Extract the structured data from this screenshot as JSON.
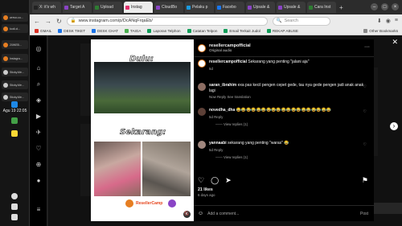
{
  "taskbar": {
    "windows": [
      "wrevo.co...",
      "kodi-cl...",
      "20WEB...",
      "Instagra...",
      "Sticky.Me...",
      "Sticky.Me...",
      "Sticky.Me..."
    ],
    "clock": "Agu 19 22:05"
  },
  "browser": {
    "tabs": [
      {
        "label": "X: it's wh",
        "color": "#222",
        "active": false
      },
      {
        "label": "Target A",
        "color": "#8a44c6",
        "active": false
      },
      {
        "label": "Upload",
        "color": "#2e7d32",
        "active": false
      },
      {
        "label": "Instag",
        "color": "#e1306c",
        "active": true
      },
      {
        "label": "CloudBo",
        "color": "#8a44c6",
        "active": false
      },
      {
        "label": "Pelaku p",
        "color": "#1b9be0",
        "active": false
      },
      {
        "label": "Facebo",
        "color": "#1877f2",
        "active": false
      },
      {
        "label": "Upsale &",
        "color": "#8a44c6",
        "active": false
      },
      {
        "label": "Upsale &",
        "color": "#8a44c6",
        "active": false
      },
      {
        "label": "Cara Inst",
        "color": "#2e7d32",
        "active": false
      }
    ],
    "new_tab": "+",
    "url": "www.instagram.com/p/DcANqFrqaEb/",
    "search_placeholder": "Search",
    "bookmarks": [
      {
        "label": "GMAIL",
        "color": "#d93025"
      },
      {
        "label": "DESK TIKET",
        "color": "#1a73e8"
      },
      {
        "label": "DESK CHAT",
        "color": "#1a73e8"
      },
      {
        "label": "TAIGA",
        "color": "#4caf50"
      },
      {
        "label": "Laporan Telphon",
        "color": "#0f9d58"
      },
      {
        "label": "Catatan Telpon",
        "color": "#0f9d58"
      },
      {
        "label": "Email Terkait Judol",
        "color": "#0f9d58"
      },
      {
        "label": "REKAP ABUSE",
        "color": "#0f9d58"
      }
    ],
    "other_bookmarks": "Other Bookmarks"
  },
  "post": {
    "media": {
      "top_caption": "Dulu:",
      "bottom_caption": "Sekarang:",
      "brand": "ResellerCamp"
    },
    "header": {
      "username": "resellercampofficial",
      "subtitle": "Original audio"
    },
    "comments": [
      {
        "user": "resellercampofficial",
        "text": "Sekarang yang penting \"jalani aja\"",
        "meta": "5d",
        "replies": ""
      },
      {
        "user": "saran_ibrahim",
        "text": "exa pas kecil pengen cepet gede, tau nya gede pengen jadi anak anak lagi",
        "meta": "Now   Reply   See translation",
        "replies": ""
      },
      {
        "user": "novedha_dha",
        "text": "😂😂😂😂😂😂😂😂😂😂😂😂😂😂😂😂😂😂😂",
        "meta": "5d   Reply",
        "replies": "—— View replies (1)"
      },
      {
        "user": "yannaabi",
        "text": "sekarang yang penting \"waras\" 😂",
        "meta": "5d   Reply",
        "replies": "—— View replies (1)"
      }
    ],
    "likes": "21 likes",
    "ago": "6 days ago",
    "add_comment_placeholder": "Add a comment...",
    "post_label": "Post"
  },
  "messages": "Messages"
}
